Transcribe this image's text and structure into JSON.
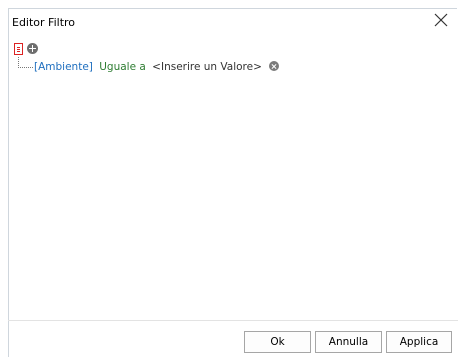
{
  "window": {
    "title": "Editor Filtro"
  },
  "condition": {
    "field": "[Ambiente]",
    "operator": "Uguale a",
    "value": "<Inserire un Valore>"
  },
  "buttons": {
    "ok": "Ok",
    "cancel": "Annulla",
    "apply": "Applica"
  },
  "colors": {
    "field": "#1f6fbf",
    "operator": "#2e7d32",
    "group_icon": "#dd2222"
  },
  "icons": {
    "root": "group-and-icon",
    "add": "plus-circle-icon",
    "remove": "x-circle-icon",
    "close": "close-icon"
  }
}
